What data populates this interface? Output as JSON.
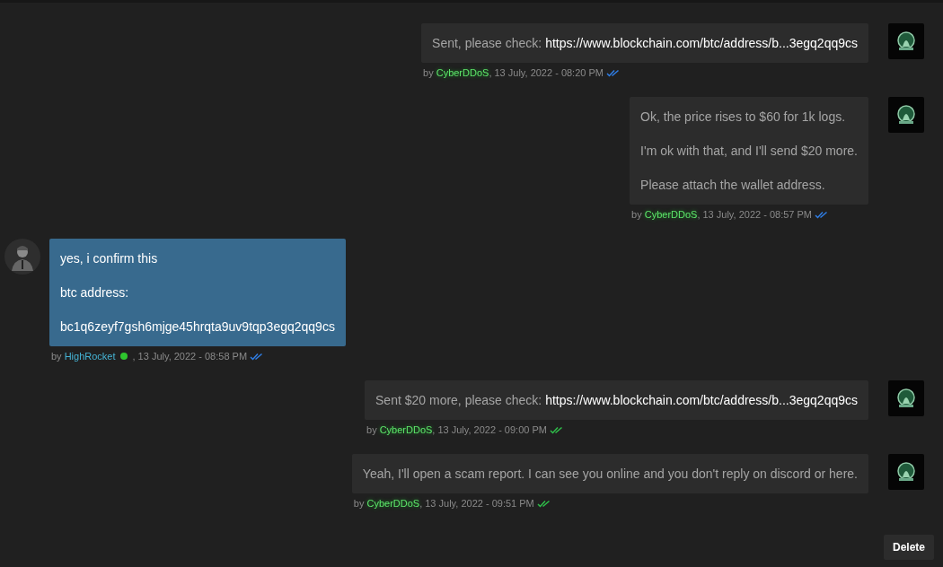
{
  "messages": [
    {
      "kind": "outgoing",
      "paragraphs": [
        {
          "text": "Sent, please check: ",
          "link": "https://www.blockchain.com/btc/address/b...3egq2qq9cs"
        }
      ],
      "by": "by",
      "author": "CyberDDoS",
      "online": false,
      "date": ", 13 July, 2022 - 08:20 PM",
      "read": true
    },
    {
      "kind": "outgoing",
      "paragraphs": [
        {
          "text": "Ok, the price rises to $60 for 1k logs."
        },
        {
          "text": "I'm ok with that, and I'll send $20 more."
        },
        {
          "text": "Please attach the wallet address."
        }
      ],
      "by": "by",
      "author": "CyberDDoS",
      "online": false,
      "date": ", 13 July, 2022 - 08:57 PM",
      "read": true
    },
    {
      "kind": "incoming",
      "paragraphs": [
        {
          "text": "yes, i confirm this"
        },
        {
          "text": "btc address:"
        },
        {
          "text": "bc1q6zeyf7gsh6mjge45hrqta9uv9tqp3egq2qq9cs"
        }
      ],
      "by": "by",
      "author": "HighRocket",
      "online": true,
      "date": ", 13 July, 2022 - 08:58 PM",
      "read": true
    },
    {
      "kind": "outgoing",
      "paragraphs": [
        {
          "text": "Sent $20 more, please check: ",
          "link": "https://www.blockchain.com/btc/address/b...3egq2qq9cs"
        }
      ],
      "by": "by",
      "author": "CyberDDoS",
      "online": false,
      "date": ", 13 July, 2022 - 09:00 PM",
      "read": false
    },
    {
      "kind": "outgoing",
      "paragraphs": [
        {
          "text": "Yeah, I'll open a scam report. I can see you online and you don't reply on discord or here."
        }
      ],
      "by": "by",
      "author": "CyberDDoS",
      "online": false,
      "date": ", 13 July, 2022 - 09:51 PM",
      "read": false
    }
  ],
  "delete_button": "Delete"
}
